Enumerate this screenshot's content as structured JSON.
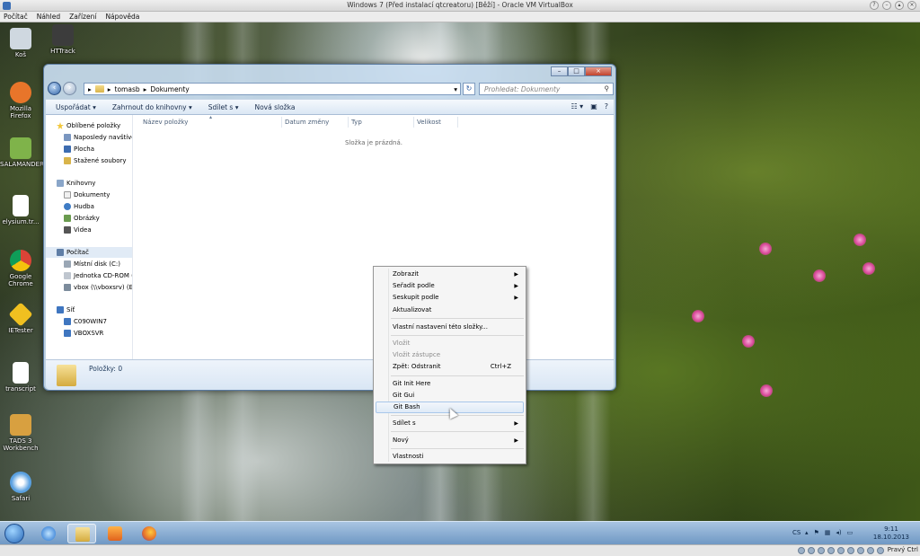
{
  "vbox": {
    "title": "Windows 7 (Před instalací qtcreatoru) [Běží] - Oracle VM VirtualBox",
    "menu": [
      "Počítač",
      "Náhled",
      "Zařízení",
      "Nápověda"
    ],
    "host_key": "Pravý Ctrl"
  },
  "desktop_icons": [
    {
      "label": "Koš",
      "icon": "recycle-bin-icon",
      "color": "#cfd8e0"
    },
    {
      "label": "HTTrack",
      "icon": "httrack-icon",
      "color": "#3c3c3c"
    },
    {
      "label": "Mozilla Firefox",
      "icon": "firefox-icon",
      "color": "#e8752a"
    },
    {
      "label": "SALAMANDER",
      "icon": "salamander-icon",
      "color": "#7fb34a"
    },
    {
      "label": "elysium.tr...",
      "icon": "document-icon",
      "color": "#ffffff"
    },
    {
      "label": "Google Chrome",
      "icon": "chrome-icon",
      "color": "#4a8ad8"
    },
    {
      "label": "IETester",
      "icon": "ietester-icon",
      "color": "#f0c020"
    },
    {
      "label": "transcript",
      "icon": "document-icon",
      "color": "#ffffff"
    },
    {
      "label": "TADS 3 Workbench",
      "icon": "tads-icon",
      "color": "#d8a040"
    },
    {
      "label": "Safari",
      "icon": "safari-icon",
      "color": "#5aa0e0"
    }
  ],
  "explorer": {
    "breadcrumb": [
      "tomasb",
      "Dokumenty"
    ],
    "search_placeholder": "Prohledat: Dokumenty",
    "toolbar": [
      "Uspořádat ▾",
      "Zahrnout do knihovny ▾",
      "Sdílet s ▾",
      "Nová složka"
    ],
    "nav": {
      "favorites": {
        "label": "Oblíbené položky",
        "items": [
          "Naposledy navštíver",
          "Plocha",
          "Stažené soubory"
        ]
      },
      "libraries": {
        "label": "Knihovny",
        "items": [
          "Dokumenty",
          "Hudba",
          "Obrázky",
          "Videa"
        ]
      },
      "computer": {
        "label": "Počítač",
        "items": [
          "Místní disk (C:)",
          "Jednotka CD-ROM (",
          "vbox (\\\\vboxsrv) (E:)"
        ]
      },
      "network": {
        "label": "Síť",
        "items": [
          "C090WIN7",
          "VBOXSVR"
        ]
      }
    },
    "columns": [
      "Název položky",
      "Datum změny",
      "Typ",
      "Velikost"
    ],
    "empty_message": "Složka je prázdná.",
    "status": "Položky: 0"
  },
  "context_menu": {
    "items": [
      {
        "label": "Zobrazit",
        "submenu": true
      },
      {
        "label": "Seřadit podle",
        "submenu": true
      },
      {
        "label": "Seskupit podle",
        "submenu": true
      },
      {
        "label": "Aktualizovat"
      },
      {
        "label": "Vlastní nastavení této složky..."
      },
      {
        "label": "Vložit",
        "disabled": true
      },
      {
        "label": "Vložit zástupce",
        "disabled": true
      },
      {
        "label": "Zpět: Odstranit",
        "shortcut": "Ctrl+Z"
      },
      {
        "label": "Git Init Here"
      },
      {
        "label": "Git Gui"
      },
      {
        "label": "Git Bash",
        "hover": true
      },
      {
        "label": "Sdílet s",
        "submenu": true
      },
      {
        "label": "Nový",
        "submenu": true
      },
      {
        "label": "Vlastnosti"
      }
    ]
  },
  "taskbar": {
    "language": "CS",
    "time": "9:11",
    "date": "18.10.2013"
  }
}
